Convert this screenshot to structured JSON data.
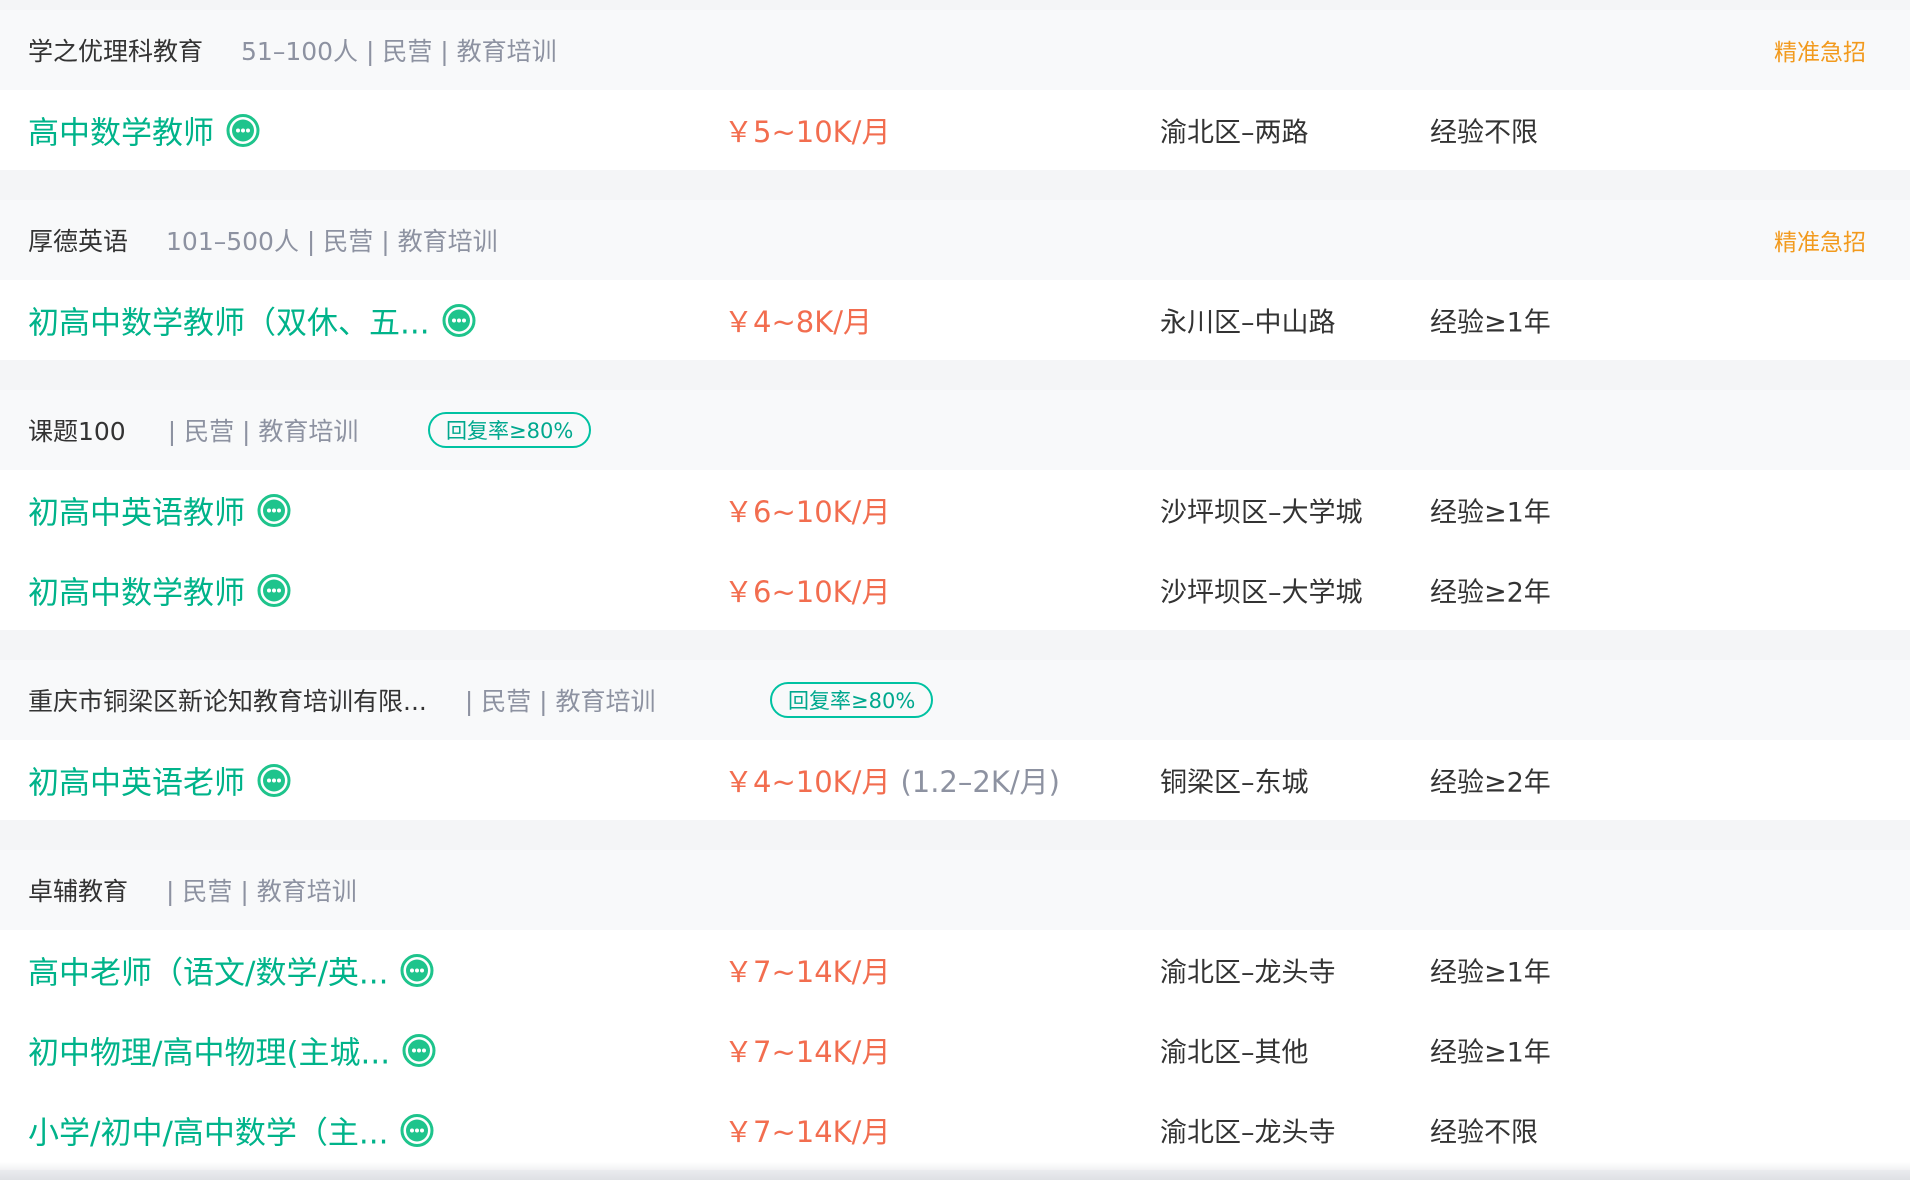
{
  "colors": {
    "job_title": "#00b38a",
    "salary": "#f26d4f",
    "urgent": "#f29a1d",
    "reply_badge": "#00c2a2",
    "meta": "#8d92a1"
  },
  "companies": [
    {
      "name": "学之优理科教育",
      "meta": "51–100人 | 民营 | 教育培训",
      "badge": "",
      "urgent": "精准急招",
      "jobs": [
        {
          "title": "高中数学教师",
          "salary": "￥5~10K/月",
          "salary_extra": "",
          "location": "渝北区–两路",
          "experience": "经验不限"
        }
      ]
    },
    {
      "name": "厚德英语",
      "meta": "101–500人 | 民营 | 教育培训",
      "badge": "",
      "urgent": "精准急招",
      "jobs": [
        {
          "title": "初高中数学教师（双休、五...",
          "salary": "￥4~8K/月",
          "salary_extra": "",
          "location": "永川区–中山路",
          "experience": "经验≥1年"
        }
      ]
    },
    {
      "name": "课题100",
      "meta": "| 民营 | 教育培训",
      "badge": "回复率≥80%",
      "urgent": "",
      "jobs": [
        {
          "title": "初高中英语教师",
          "salary": "￥6~10K/月",
          "salary_extra": "",
          "location": "沙坪坝区–大学城",
          "experience": "经验≥1年"
        },
        {
          "title": "初高中数学教师",
          "salary": "￥6~10K/月",
          "salary_extra": "",
          "location": "沙坪坝区–大学城",
          "experience": "经验≥2年"
        }
      ]
    },
    {
      "name": "重庆市铜梁区新论知教育培训有限...",
      "meta": "| 民营 | 教育培训",
      "badge": "回复率≥80%",
      "urgent": "",
      "jobs": [
        {
          "title": "初高中英语老师",
          "salary": "￥4~10K/月",
          "salary_extra": "(1.2–2K/月)",
          "location": "铜梁区–东城",
          "experience": "经验≥2年"
        }
      ]
    },
    {
      "name": "卓辅教育",
      "meta": "| 民营 | 教育培训",
      "badge": "",
      "urgent": "",
      "jobs": [
        {
          "title": "高中老师（语文/数学/英...",
          "salary": "￥7~14K/月",
          "salary_extra": "",
          "location": "渝北区–龙头寺",
          "experience": "经验≥1年"
        },
        {
          "title": "初中物理/高中物理(主城...",
          "salary": "￥7~14K/月",
          "salary_extra": "",
          "location": "渝北区–其他",
          "experience": "经验≥1年"
        },
        {
          "title": "小学/初中/高中数学（主...",
          "salary": "￥7~14K/月",
          "salary_extra": "",
          "location": "渝北区–龙头寺",
          "experience": "经验不限"
        }
      ]
    }
  ]
}
